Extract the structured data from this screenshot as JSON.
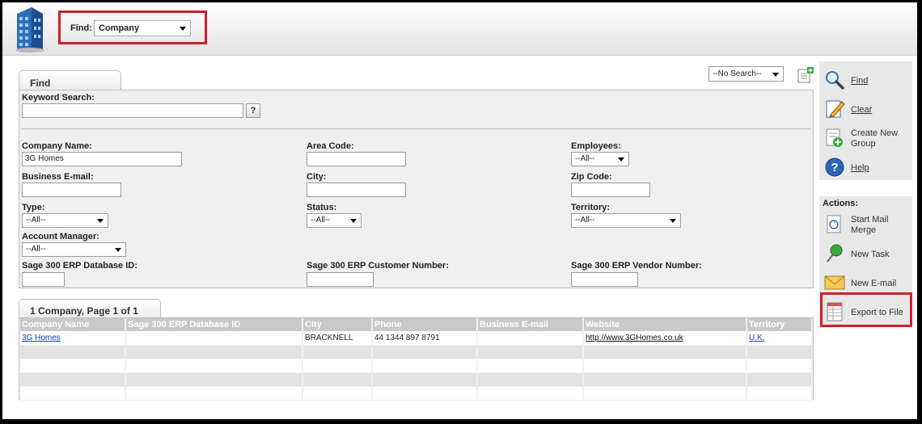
{
  "header": {
    "find_label": "Find:",
    "find_value": "Company"
  },
  "search_select": "--No Search--",
  "find_tab": "Find",
  "form": {
    "keyword_label": "Keyword Search:",
    "keyword_value": "",
    "help_glyph": "?",
    "company_name_label": "Company Name:",
    "company_name_value": "3G Homes",
    "area_code_label": "Area Code:",
    "employees_label": "Employees:",
    "employees_value": "--All--",
    "business_email_label": "Business E-mail:",
    "city_label": "City:",
    "zip_label": "Zip Code:",
    "type_label": "Type:",
    "type_value": "--All--",
    "status_label": "Status:",
    "status_value": "--All--",
    "territory_label": "Territory:",
    "territory_value": "--All--",
    "account_manager_label": "Account Manager:",
    "account_manager_value": "--All--",
    "sage_db_label": "Sage 300 ERP Database ID:",
    "sage_customer_label": "Sage 300 ERP Customer Number:",
    "sage_vendor_label": "Sage 300 ERP Vendor Number:"
  },
  "results": {
    "tab_label": "1 Company, Page 1 of 1",
    "columns": [
      "Company Name",
      "Sage 300 ERP Database ID",
      "City",
      "Phone",
      "Business E-mail",
      "Website",
      "Territory"
    ],
    "row": {
      "company": "3G Homes",
      "db_id": "",
      "city": "BRACKNELL",
      "phone": "44 1344 897 8791",
      "email": "",
      "website": "http://www.3GHomes.co.uk",
      "territory": "U.K."
    }
  },
  "sidebar": {
    "find": "Find",
    "clear": "Clear",
    "create_group": "Create New Group",
    "help": "Help",
    "actions_label": "Actions:",
    "mail_merge": "Start Mail Merge",
    "new_task": "New Task",
    "new_email": "New E-mail",
    "export": "Export to File"
  },
  "colors": {
    "highlight": "#d0202a",
    "link": "#1a3fa8",
    "header_cell": "#c9c9c9"
  }
}
